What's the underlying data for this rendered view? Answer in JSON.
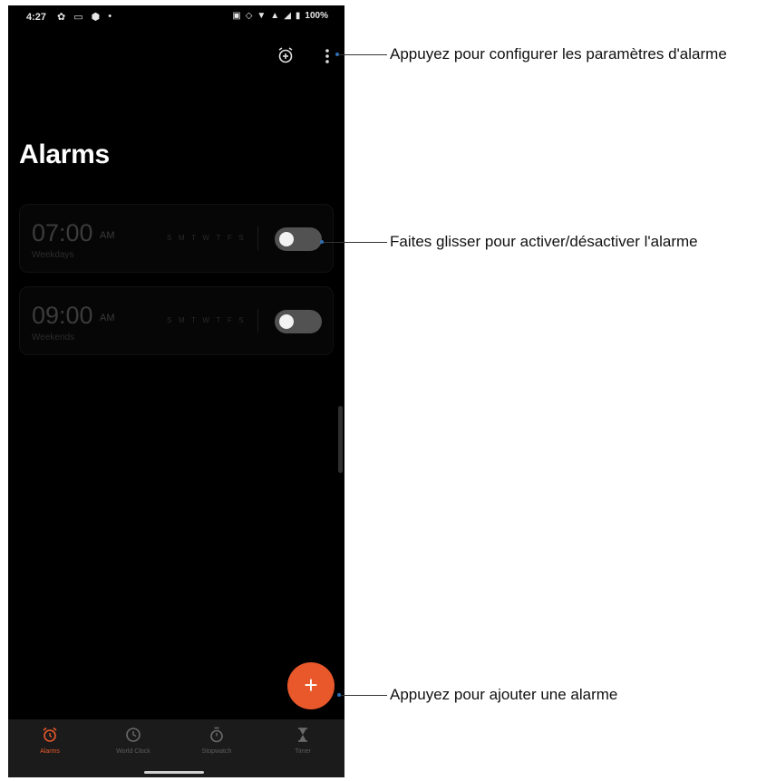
{
  "status_bar": {
    "time": "4:27",
    "battery": "100%",
    "left_icons": [
      "gear-icon",
      "message-icon",
      "shield-icon",
      "dot-icon"
    ],
    "right_icons": [
      "cast-icon",
      "sync-icon",
      "wifi-icon",
      "data-icon",
      "signal-icon",
      "battery-icon"
    ]
  },
  "app_bar": {
    "icons": [
      "add-alarm-icon",
      "more-vert-icon"
    ]
  },
  "page": {
    "title": "Alarms"
  },
  "alarms": [
    {
      "time": "07:00",
      "ampm": "AM",
      "label": "Weekdays",
      "days": [
        "S",
        "M",
        "T",
        "W",
        "T",
        "F",
        "S"
      ],
      "enabled": false
    },
    {
      "time": "09:00",
      "ampm": "AM",
      "label": "Weekends",
      "days": [
        "S",
        "M",
        "T",
        "W",
        "T",
        "F",
        "S"
      ],
      "enabled": false
    }
  ],
  "fab": {
    "label": "+"
  },
  "bottom_nav": {
    "items": [
      {
        "label": "Alarms",
        "icon": "alarm-icon",
        "active": true
      },
      {
        "label": "World Clock",
        "icon": "clock-icon",
        "active": false
      },
      {
        "label": "Stopwatch",
        "icon": "stopwatch-icon",
        "active": false
      },
      {
        "label": "Timer",
        "icon": "hourglass-icon",
        "active": false
      }
    ]
  },
  "annotations": {
    "settings": "Appuyez pour configurer les paramètres d'alarme",
    "toggle": "Faites glisser pour activer/désactiver l'alarme",
    "add": "Appuyez pour ajouter une alarme"
  },
  "colors": {
    "accent": "#e8582b",
    "background": "#000000",
    "nav_background": "#1b1b1b",
    "callout_dot": "#2e6fb5"
  }
}
